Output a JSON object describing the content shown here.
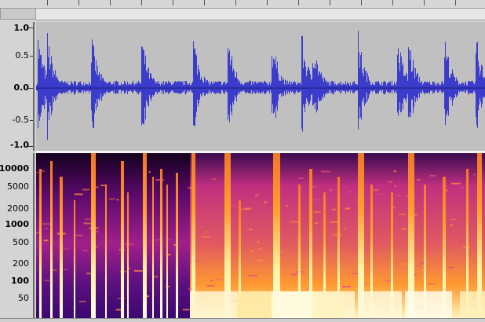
{
  "waveform_scale": {
    "labels": [
      "1.0",
      "0.5",
      "0.0",
      "-0.5",
      "-1.0"
    ]
  },
  "spectrogram_scale": {
    "labels": [
      "10000",
      "5000",
      "2000",
      "1000",
      "500",
      "200",
      "100",
      "50"
    ]
  },
  "colors": {
    "waveform": "#3c3ccc",
    "waveform_bg": "#c0c0c0",
    "centerline": "#202080",
    "spectrogram_low": "#1a0030",
    "spectrogram_mid": "#c02080",
    "spectrogram_high": "#ffe090"
  }
}
